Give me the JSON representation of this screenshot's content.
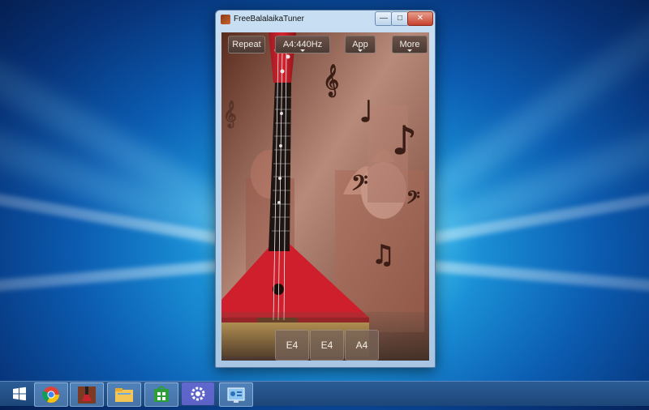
{
  "window": {
    "title": "FreeBalalaikaTuner",
    "controls": {
      "minimize": "—",
      "maximize": "□",
      "close": "✕"
    }
  },
  "toolbar": {
    "repeat": "Repeat",
    "frequency": "A4:440Hz",
    "app": "App",
    "more": "More"
  },
  "strings": [
    "E4",
    "E4",
    "A4"
  ],
  "taskbar": {
    "items": [
      "windows-start-icon",
      "chrome-icon",
      "balalaika-app-icon",
      "file-explorer-icon",
      "store-icon",
      "settings-icon",
      "control-panel-icon"
    ]
  },
  "colors": {
    "accent_red": "#c91f2a",
    "wood": "#e2b65a",
    "taskbar": "#1f4b80"
  }
}
